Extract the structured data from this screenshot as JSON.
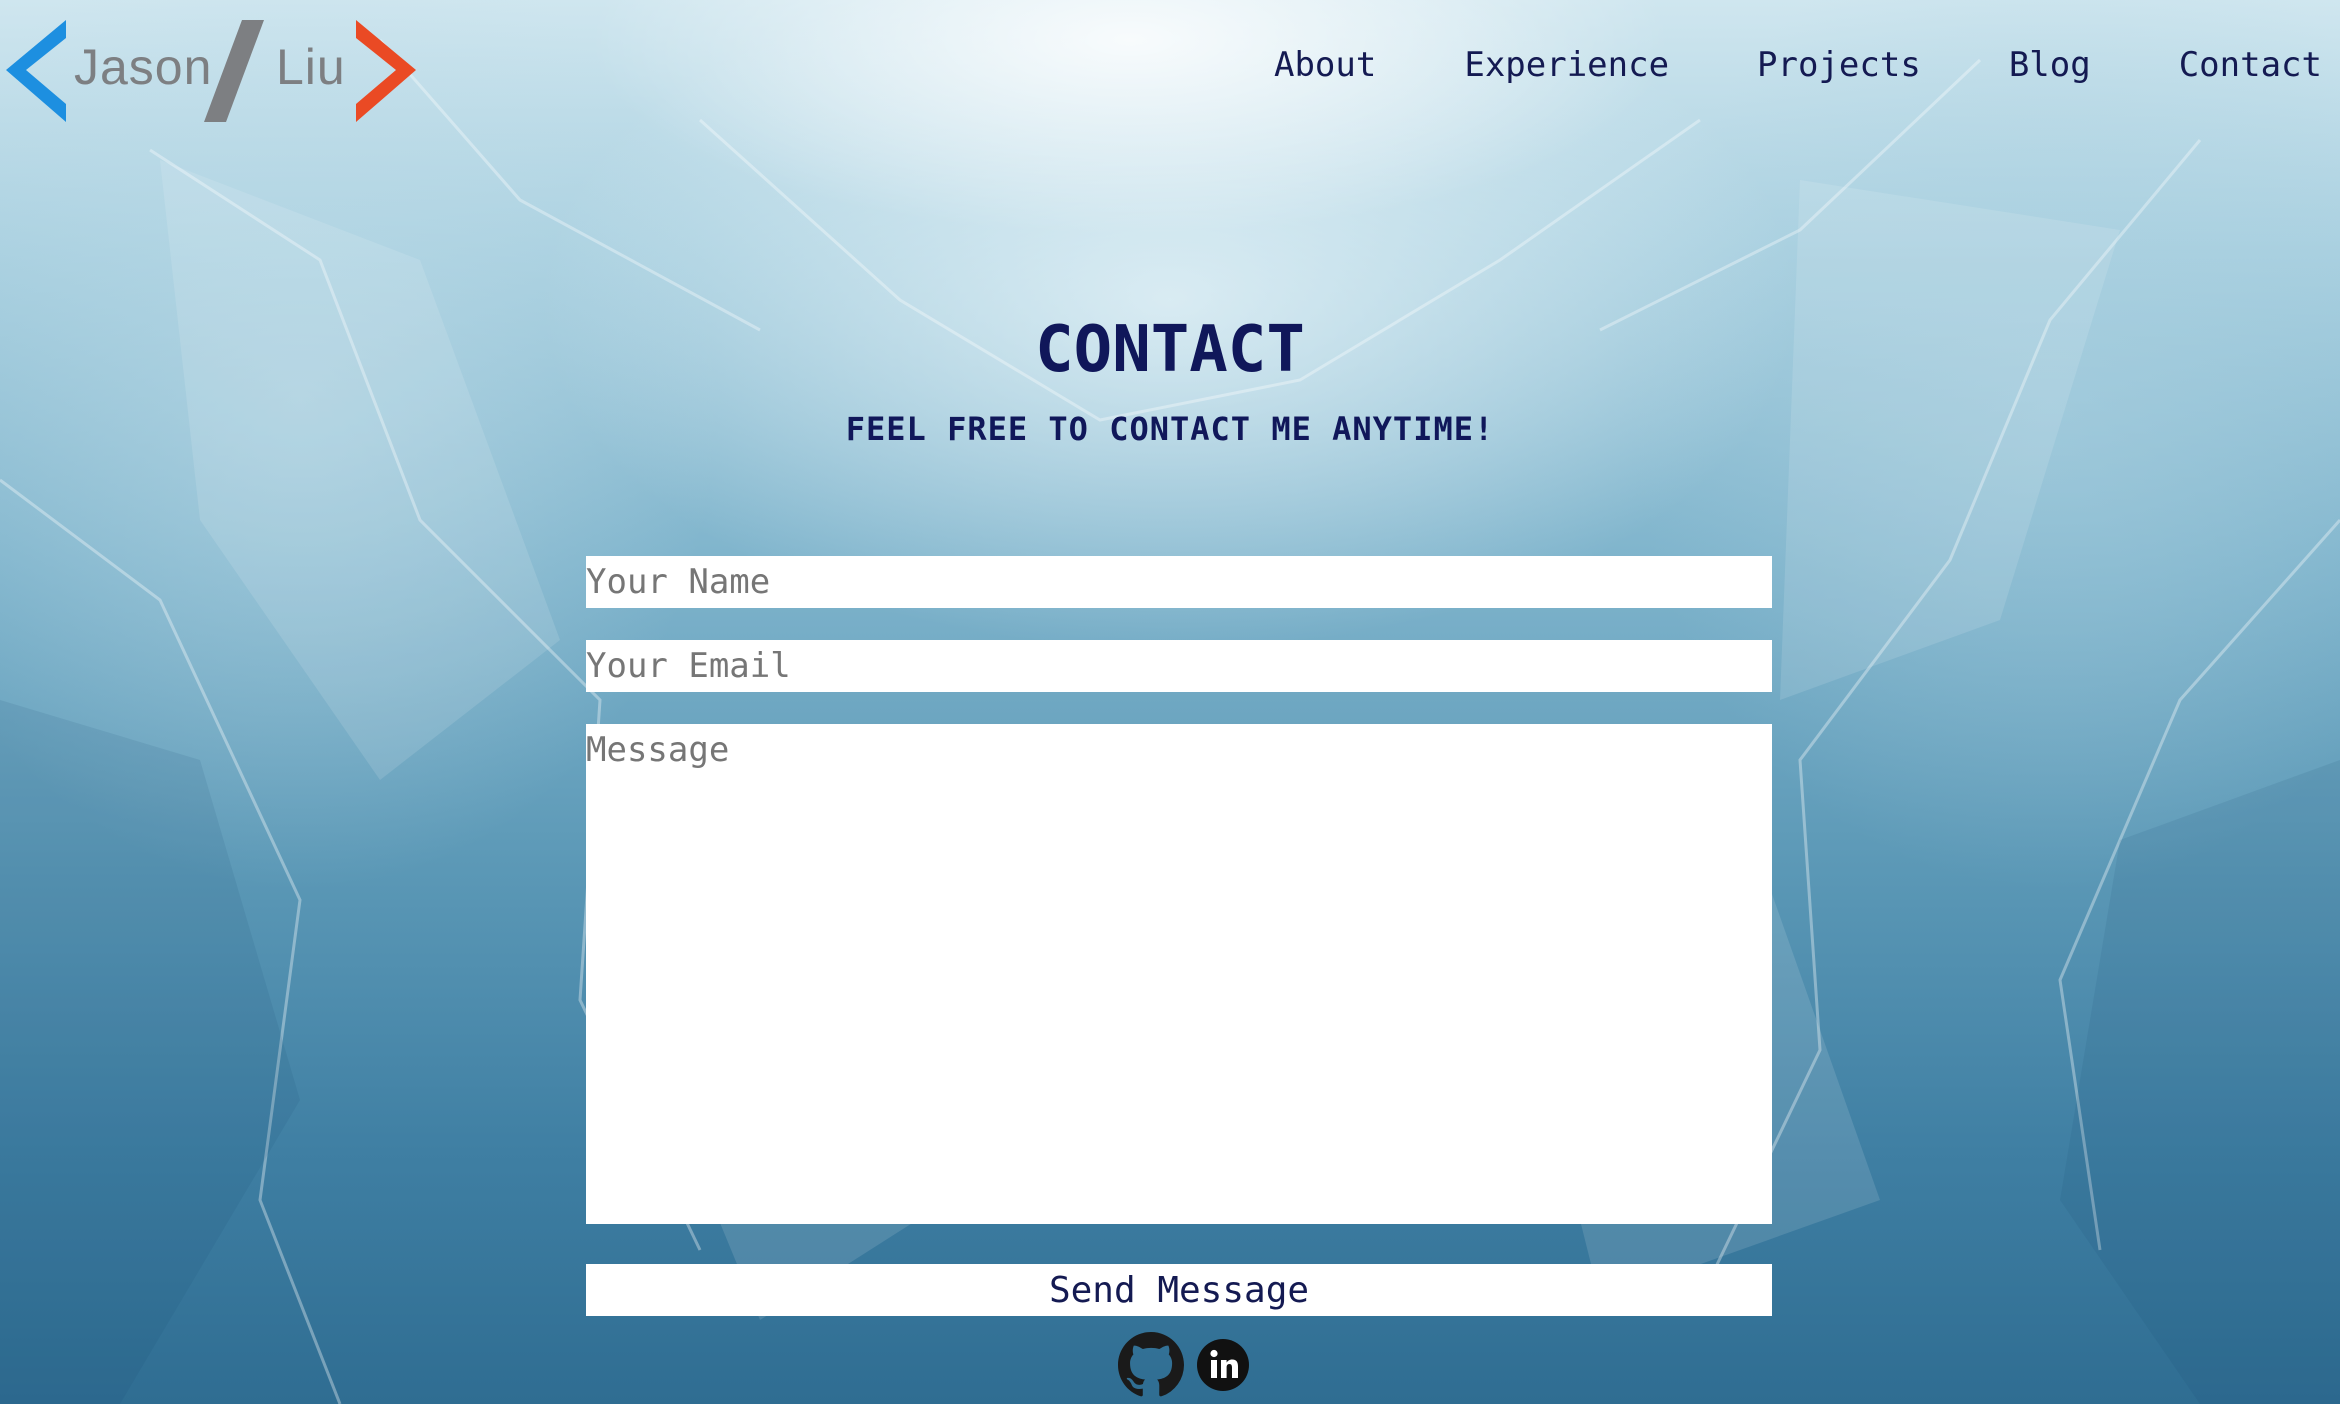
{
  "logo": {
    "first_name": "Jason",
    "last_name": "Liu",
    "colors": {
      "left_chevron": "#1d8fe0",
      "slash": "#7d7f82",
      "right_chevron": "#ea4a24"
    }
  },
  "nav": {
    "items": [
      {
        "label": "About"
      },
      {
        "label": "Experience"
      },
      {
        "label": "Projects"
      },
      {
        "label": "Blog"
      },
      {
        "label": "Contact"
      }
    ]
  },
  "contact": {
    "title": "CONTACT",
    "subtitle": "FEEL FREE TO CONTACT ME ANYTIME!",
    "form": {
      "name_placeholder": "Your Name",
      "name_value": "",
      "email_placeholder": "Your Email",
      "email_value": "",
      "message_placeholder": "Message",
      "message_value": "",
      "submit_label": "Send Message"
    }
  },
  "social": {
    "icons": [
      "github-icon",
      "linkedin-icon"
    ]
  },
  "colors": {
    "text_primary": "#10175a",
    "field_background": "#ffffff",
    "placeholder": "#767676"
  }
}
